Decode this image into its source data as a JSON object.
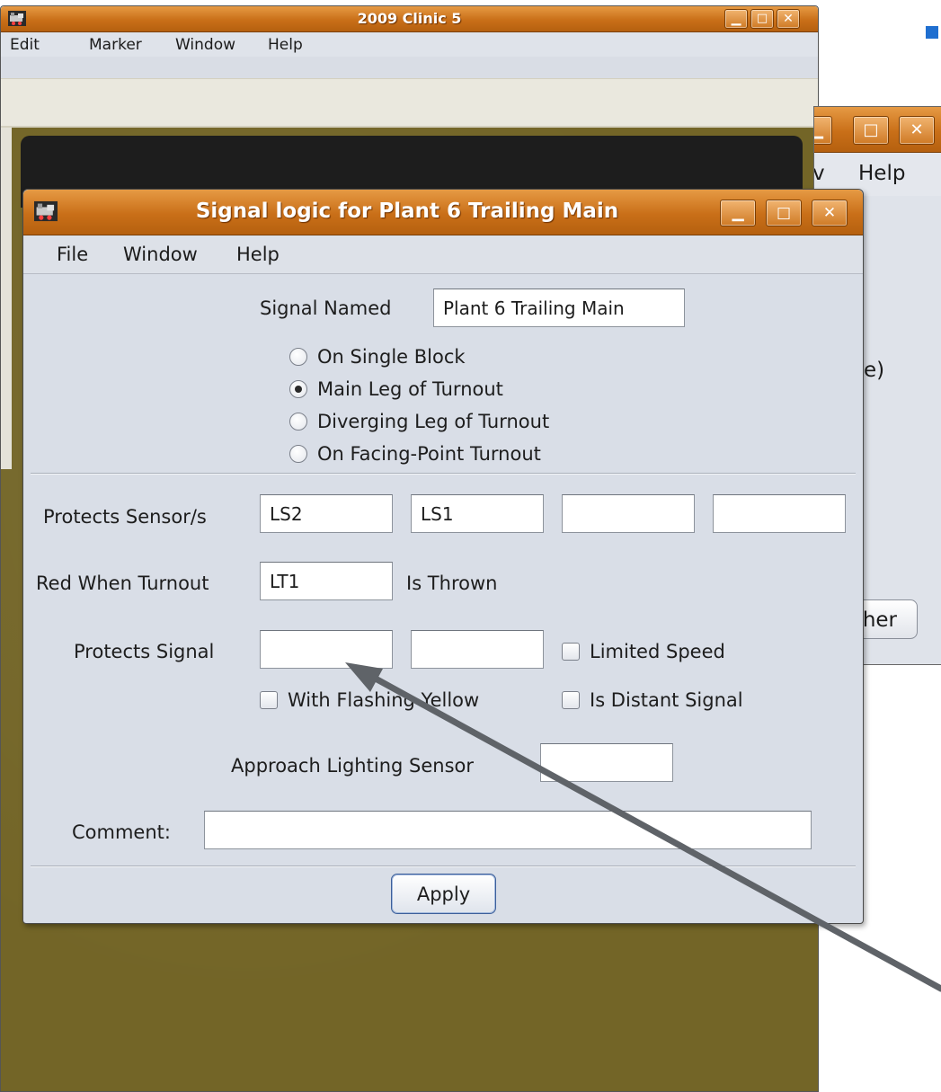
{
  "background_window": {
    "title": "2009 Clinic 5",
    "menu": [
      "Edit",
      "Marker",
      "Window",
      "Help"
    ]
  },
  "middle_window": {
    "menu_visible": [
      "v",
      "Help"
    ],
    "partial_text": "e)",
    "partial_button": "her"
  },
  "dialog": {
    "title": "Signal logic for Plant 6 Trailing Main",
    "menu": [
      "File",
      "Window",
      "Help"
    ],
    "signal_named_label": "Signal Named",
    "signal_named_value": "Plant 6 Trailing Main",
    "radio_options": [
      {
        "label": "On Single Block",
        "selected": false
      },
      {
        "label": "Main Leg of Turnout",
        "selected": true
      },
      {
        "label": "Diverging Leg of Turnout",
        "selected": false
      },
      {
        "label": "On Facing-Point Turnout",
        "selected": false
      }
    ],
    "protects_sensors_label": "Protects Sensor/s",
    "protects_sensors": [
      "LS2",
      "LS1",
      "",
      ""
    ],
    "red_when_turnout_label": "Red When Turnout",
    "red_when_turnout_value": "LT1",
    "is_thrown_label": "Is Thrown",
    "protects_signal_label": "Protects Signal",
    "protects_signal_values": [
      "",
      ""
    ],
    "limited_speed_label": "Limited Speed",
    "limited_speed_checked": false,
    "flashing_yellow_label": "With Flashing Yellow",
    "flashing_yellow_checked": false,
    "distant_signal_label": "Is Distant Signal",
    "distant_signal_checked": false,
    "approach_lighting_label": "Approach Lighting Sensor",
    "approach_lighting_value": "",
    "comment_label": "Comment:",
    "comment_value": "",
    "apply_label": "Apply"
  },
  "icons": {
    "window_icon": "locomotive-icon",
    "minimize": "minimize-icon",
    "maximize": "maximize-icon",
    "close": "close-icon",
    "annotation_arrow": "arrow-icon"
  },
  "colors": {
    "titlebar": "#c96f18",
    "panel_olive": "#736527",
    "dialog_bg": "#d9dee7",
    "arrow": "#5f6368",
    "bullet": "#1f6fd0"
  }
}
